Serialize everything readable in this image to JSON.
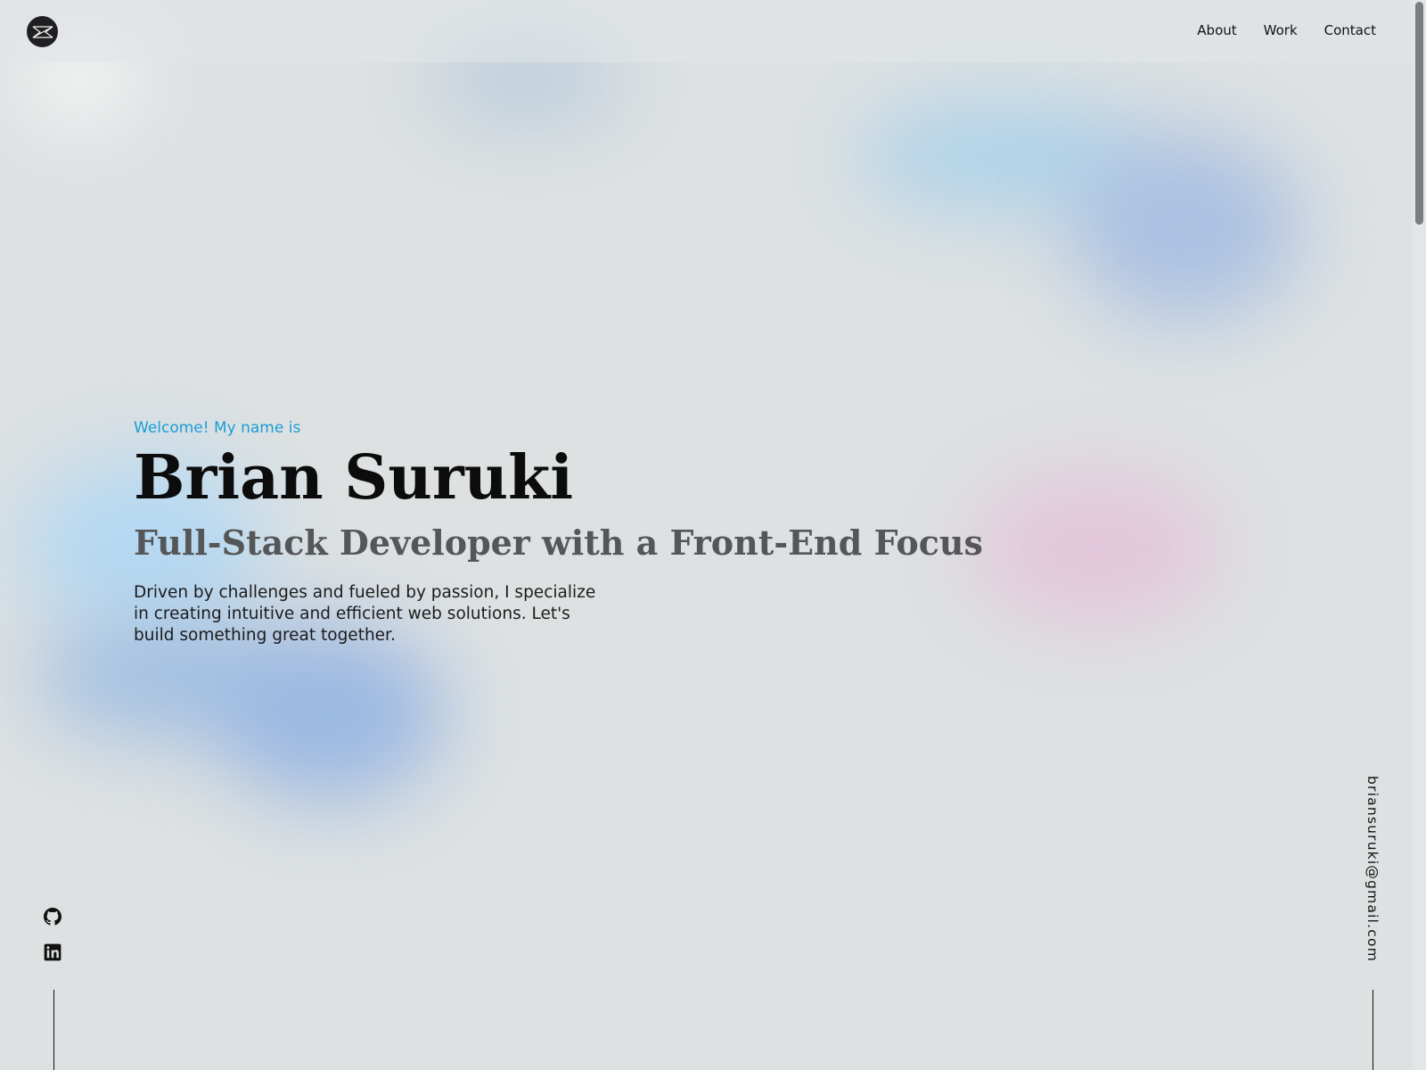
{
  "header": {
    "logo_alt": "BS",
    "nav": [
      {
        "label": "About"
      },
      {
        "label": "Work"
      },
      {
        "label": "Contact"
      }
    ]
  },
  "hero": {
    "welcome": "Welcome! My name is",
    "name": "Brian Suruki",
    "role": "Full-Stack Developer with a Front-End Focus",
    "description": "Driven by challenges and fueled by passion, I specialize in creating intuitive and efficient web solutions. Let's build something great together."
  },
  "social": [
    {
      "icon": "github-icon"
    },
    {
      "icon": "linkedin-icon"
    }
  ],
  "email": "briansuruki@gmail.com",
  "colors": {
    "accent": "#1a9dd4",
    "background": "#dde1e2",
    "heading": "#0c0c0c",
    "subheading": "#555657"
  }
}
